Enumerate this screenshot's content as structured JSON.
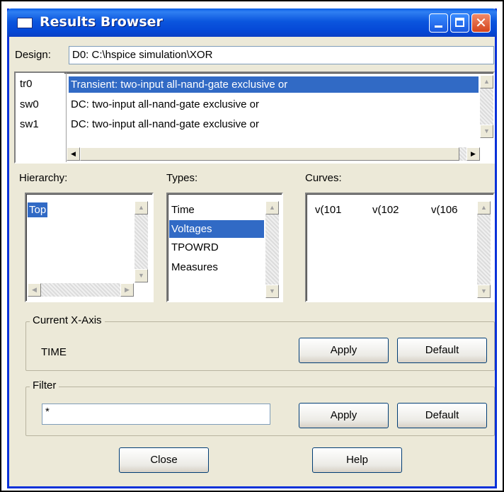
{
  "window": {
    "title": "Results Browser"
  },
  "titlebar": {
    "close_glyph": "✕"
  },
  "design": {
    "label": "Design:",
    "value": "D0: C:\\hspice simulation\\XOR"
  },
  "analyses": {
    "ids": [
      "tr0",
      "sw0",
      "sw1"
    ],
    "titles": [
      "Transient: two-input all-nand-gate exclusive or",
      "DC: two-input all-nand-gate exclusive or",
      "DC: two-input all-nand-gate exclusive or"
    ],
    "selected_index": 0
  },
  "hierarchy": {
    "label": "Hierarchy:",
    "items": [
      "Top"
    ],
    "selected_index": 0
  },
  "types": {
    "label": "Types:",
    "items": [
      "Time",
      "Voltages",
      "TPOWRD",
      "Measures"
    ],
    "selected_index": 1
  },
  "curves": {
    "label": "Curves:",
    "items": [
      "v(101",
      "v(102",
      "v(106"
    ]
  },
  "xaxis": {
    "legend": "Current X-Axis",
    "value": "TIME",
    "apply_label": "Apply",
    "default_label": "Default"
  },
  "filter": {
    "legend": "Filter",
    "value": "*",
    "apply_label": "Apply",
    "default_label": "Default"
  },
  "footer": {
    "close_label": "Close",
    "help_label": "Help"
  },
  "scroll_glyphs": {
    "up": "▲",
    "down": "▼",
    "left": "◀",
    "right": "▶"
  },
  "colors": {
    "title_bar": "#0a5fe8",
    "selection": "#316ac5",
    "window_face": "#ece9d8",
    "close_button": "#d4441c"
  }
}
